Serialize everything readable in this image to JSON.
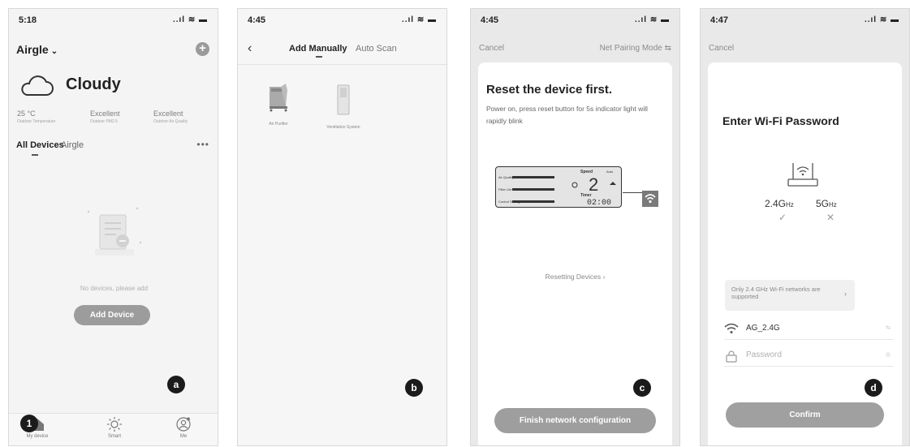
{
  "screens": {
    "s1": {
      "time": "5:18",
      "status_icons": "..ıl ≋ ▬",
      "home_name": "Airgle",
      "chevron": "⌄",
      "plus": "+",
      "weather": "Cloudy",
      "metrics": [
        {
          "value": "25 °C",
          "label": "Outdoor Temperature"
        },
        {
          "value": "Excellent",
          "label": "Outdoor PM2.5"
        },
        {
          "value": "Excellent",
          "label": "Outdoor Air Quality"
        }
      ],
      "tabs": {
        "all": "All Devices",
        "airgle": "Airgle",
        "more": "•••"
      },
      "empty_text": "No devices, please add",
      "add_device": "Add Device",
      "nav": [
        {
          "label": "My device",
          "icon": "home-icon"
        },
        {
          "label": "Smart",
          "icon": "sun-icon"
        },
        {
          "label": "Me",
          "icon": "profile-icon"
        }
      ],
      "badge": "a",
      "badge_num": "1"
    },
    "s2": {
      "time": "4:45",
      "status_icons": "..ıl ≋ ▬",
      "back": "‹",
      "tab_manual": "Add Manually",
      "tab_scan": "Auto Scan",
      "products": [
        {
          "label": "Air Purifier",
          "icon": "air-purifier-icon"
        },
        {
          "label": "Ventilation System",
          "icon": "ventilation-system-icon"
        }
      ],
      "badge": "b"
    },
    "s3": {
      "time": "4:45",
      "status_icons": "..ıl ≋ ▬",
      "cancel": "Cancel",
      "mode": "Net Pairing Mode ⇆",
      "title": "Reset the device first.",
      "desc": "Power on, press reset button for 5s indicator light will rapidly blink",
      "lcd": {
        "speed_label": "Speed",
        "speed_value": "2",
        "timer_label": "Timer",
        "timer_value": "02:00",
        "row1": "Air Quality",
        "row2": "Filter Life",
        "row3": "Control Setting",
        "auto": "Auto"
      },
      "resetting": "Resetting Devices ›",
      "finish": "Finish network configuration",
      "badge": "c"
    },
    "s4": {
      "time": "4:47",
      "status_icons": "..ıl ≋ ▬",
      "cancel": "Cancel",
      "title": "Enter Wi-Fi Password",
      "band24": "2.4G",
      "band5": "5G",
      "hz": "Hz",
      "ok_mark": "✓",
      "no_mark": "✕",
      "hint": "Only 2.4 GHz Wi-Fi networks are supported",
      "hint_arrow": "›",
      "ssid": "AG_2.4G",
      "ssid_right": "⇆",
      "password_placeholder": "Password",
      "eye": "◎",
      "confirm": "Confirm",
      "badge": "d"
    }
  }
}
